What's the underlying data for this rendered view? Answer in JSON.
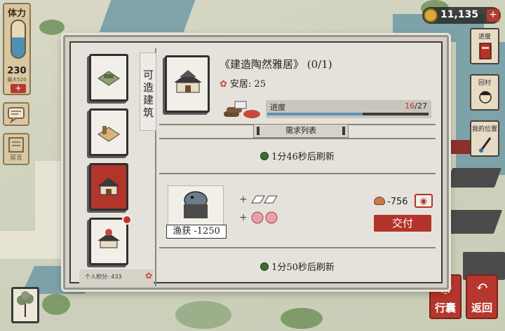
{
  "hud": {
    "stamina_title": "体力",
    "stamina_value": "230",
    "stamina_max": "最大520",
    "stamina_plus": "+",
    "message_label": "留言",
    "coins": "11,135",
    "coin_plus": "+"
  },
  "right_buttons": [
    {
      "label": "进度"
    },
    {
      "label": "回村"
    },
    {
      "label": "我的位置"
    }
  ],
  "bottom_buttons": {
    "bag": "行囊",
    "back": "返回"
  },
  "dialog": {
    "vertical_title": "可造建筑",
    "personal_score": "个人积分: 433",
    "building_title": "《建造陶然雅居》 (0/1)",
    "anju_label": "安居: 25",
    "progress_label": "进度",
    "progress_current": "16",
    "progress_total": "/27",
    "progress_fraction": 0.593,
    "section_tab": "需求列表",
    "refresh_1": "1分46秒后刷新",
    "refresh_2": "1分50秒后刷新",
    "request": {
      "item_label": "渔获 -1250",
      "cost": "-756",
      "deliver_button": "交付"
    }
  },
  "colors": {
    "accent_red": "#b3332a",
    "progress_blue": "#5c92b8",
    "panel": "#e5e2db"
  }
}
